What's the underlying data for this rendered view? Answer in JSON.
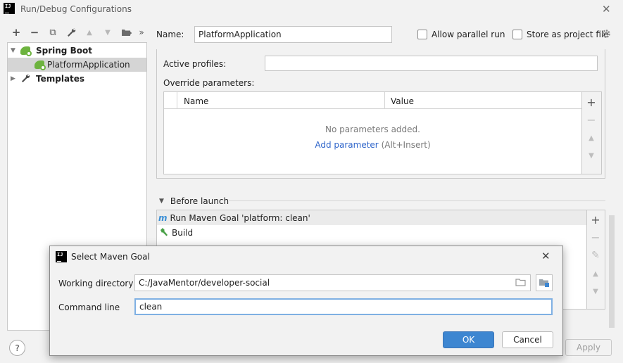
{
  "window": {
    "title": "Run/Debug Configurations",
    "close_glyph": "✕"
  },
  "toolbar": {
    "add": "+",
    "remove": "−",
    "copy": "⧉",
    "edit_defaults": "🔧",
    "move_up": "▲",
    "move_down": "▼",
    "new_folder": "📁",
    "more": "»"
  },
  "tree": {
    "items": [
      {
        "label": "Spring Boot",
        "expanded": true,
        "icon": "spring-boot-icon"
      },
      {
        "label": "PlatformApplication",
        "selected": true,
        "icon": "spring-boot-app-icon"
      },
      {
        "label": "Templates",
        "expanded": false,
        "icon": "wrench-icon"
      }
    ]
  },
  "header": {
    "name_label": "Name:",
    "name_value": "PlatformApplication",
    "allow_parallel_label": "Allow parallel run",
    "allow_parallel_checked": false,
    "store_as_project_label": "Store as project file",
    "store_as_project_checked": false
  },
  "config": {
    "active_profiles_label": "Active profiles:",
    "active_profiles_value": "",
    "override_label": "Override parameters:",
    "table": {
      "columns": [
        "Name",
        "Value"
      ],
      "empty_text": "No parameters added.",
      "add_link": "Add parameter",
      "add_hint": "(Alt+Insert)"
    },
    "side_buttons": {
      "add": "+",
      "remove": "−",
      "up": "▲",
      "down": "▼"
    }
  },
  "before_launch": {
    "title": "Before launch",
    "tasks": [
      {
        "label": "Run Maven Goal 'platform: clean'",
        "icon": "maven-icon"
      },
      {
        "label": "Build",
        "icon": "hammer-icon"
      }
    ],
    "side_buttons": {
      "add": "+",
      "remove": "−",
      "edit": "✎",
      "up": "▲",
      "down": "▼"
    }
  },
  "footer": {
    "help": "?",
    "apply": "Apply"
  },
  "dialog": {
    "title": "Select Maven Goal",
    "close_glyph": "✕",
    "working_dir_label": "Working directory",
    "working_dir_value": "C:/JavaMentor/developer-social",
    "command_line_label": "Command line",
    "command_line_value": "clean",
    "ok": "OK",
    "cancel": "Cancel"
  },
  "colors": {
    "accent": "#3d86d1",
    "link": "#2f65ca",
    "selection": "#d5d5d5",
    "focus_border": "#7fb0e3"
  }
}
